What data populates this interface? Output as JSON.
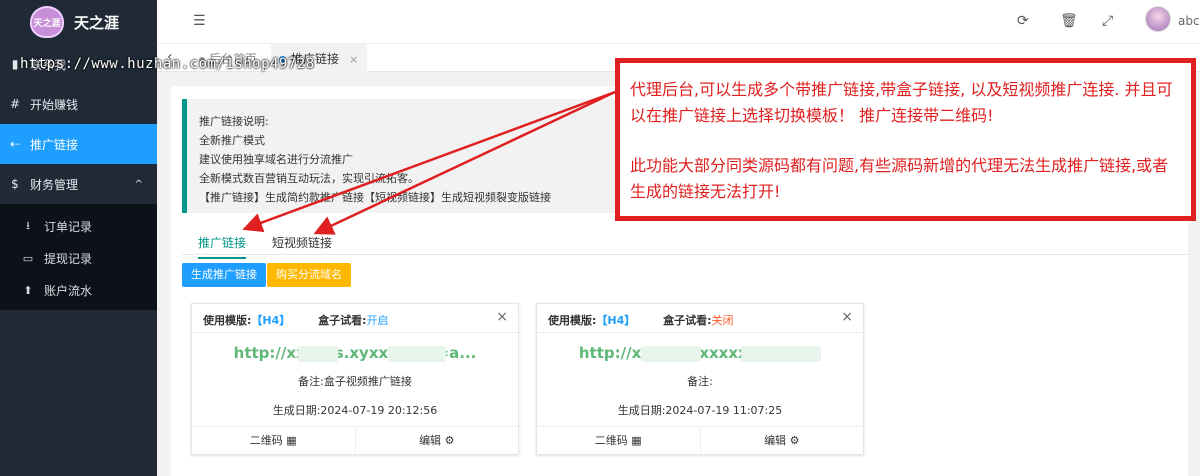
{
  "brand": {
    "name": "天之涯",
    "badge": "天之涯"
  },
  "sidebar": {
    "items": [
      {
        "label": "联系我",
        "icon": "book-icon"
      },
      {
        "label": "开始赚钱",
        "icon": "hash-icon"
      },
      {
        "label": "推广链接",
        "icon": "share-icon",
        "active": true
      },
      {
        "label": "财务管理",
        "icon": "dollar-icon",
        "caret": "^"
      }
    ],
    "sub_items": [
      {
        "label": "订单记录",
        "icon": "download-icon"
      },
      {
        "label": "提现记录",
        "icon": "visa-card-icon"
      },
      {
        "label": "账户流水",
        "icon": "arrow-up-circle-icon"
      }
    ]
  },
  "header": {
    "username": "abc"
  },
  "tabs": {
    "home": "后台首页",
    "current": "推广链接",
    "close": "×"
  },
  "watermark": "https://www.huzhan.com/1shop49728",
  "notice": {
    "lines": [
      "推广链接说明:",
      "全新推广模式",
      "建议使用独享域名进行分流推广",
      "全新模式数百营销互动玩法，实现引流拓客。",
      "【推广链接】生成简约款推广链接【短视频链接】生成短视频裂变版链接"
    ]
  },
  "subtabs": {
    "tab1": "推广链接",
    "tab2": "短视频链接"
  },
  "buttons": {
    "generate": "生成推广链接",
    "buy_domain": "购买分流域名"
  },
  "cards": [
    {
      "template_label": "使用模版:",
      "template": "【H4】",
      "trial_label": "盒子试看:",
      "trial_value": "开启",
      "url": "http://xxxxxs.xyxxxxxxx=a...",
      "remark": "备注:盒子视频推广链接",
      "date": "生成日期:2024-07-19 20:12:56",
      "qr": "二维码",
      "edit": "编辑",
      "close": "×"
    },
    {
      "template_label": "使用模版:",
      "template": "【H4】",
      "trial_label": "盒子试看:",
      "trial_value": "关闭",
      "url": "http://xxxxxxxxxxxxxxxxxxx.",
      "remark": "备注:",
      "date": "生成日期:2024-07-19 11:07:25",
      "qr": "二维码",
      "edit": "编辑",
      "close": "×"
    }
  ],
  "annotation": {
    "p1": "代理后台,可以生成多个带推广链接,带盒子链接, 以及短视频推广连接. 并且可以在推广链接上选择切换模板！ 推广连接带二维码!",
    "p2": "此功能大部分同类源码都有问题,有些源码新增的代理无法生成推广链接,或者生成的链接无法打开!"
  },
  "colors": {
    "sidebar_bg": "#1f2a36",
    "accent_blue": "#1e9fff",
    "accent_teal": "#009688",
    "link_green": "#5fb878",
    "annotation_red": "#e02020",
    "gold": "#ffb800"
  }
}
